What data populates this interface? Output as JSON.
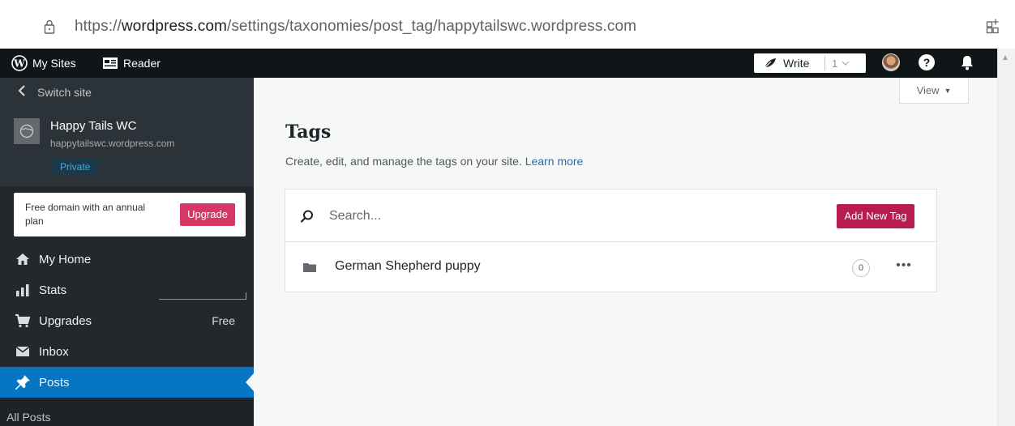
{
  "browser": {
    "url_scheme": "https://",
    "url_domain": "wordpress.com",
    "url_path": "/settings/taxonomies/post_tag/happytailswc.wordpress.com"
  },
  "masterbar": {
    "my_sites": "My Sites",
    "reader": "Reader",
    "write": "Write",
    "write_count": "1"
  },
  "sidebar": {
    "switch_site": "Switch site",
    "site_title": "Happy Tails WC",
    "site_url": "happytailswc.wordpress.com",
    "site_badge": "Private",
    "upgrade_text": "Free domain with an annual plan",
    "upgrade_button": "Upgrade",
    "items": [
      {
        "label": "My Home"
      },
      {
        "label": "Stats"
      },
      {
        "label": "Upgrades",
        "badge": "Free"
      },
      {
        "label": "Inbox"
      },
      {
        "label": "Posts"
      }
    ],
    "sub_items": [
      {
        "label": "All Posts"
      }
    ]
  },
  "main": {
    "view_button": "View",
    "title": "Tags",
    "description": "Create, edit, and manage the tags on your site.",
    "learn_more": "Learn more",
    "search_placeholder": "Search...",
    "add_button": "Add New Tag",
    "tags": [
      {
        "name": "German Shepherd puppy",
        "count": "0"
      }
    ]
  },
  "colors": {
    "masterbar": "#101517",
    "sidebar": "#23282d",
    "active_nav": "#0675c4",
    "upgrade_button": "#d63764",
    "add_button": "#b81c4e",
    "link": "#2271b1"
  }
}
